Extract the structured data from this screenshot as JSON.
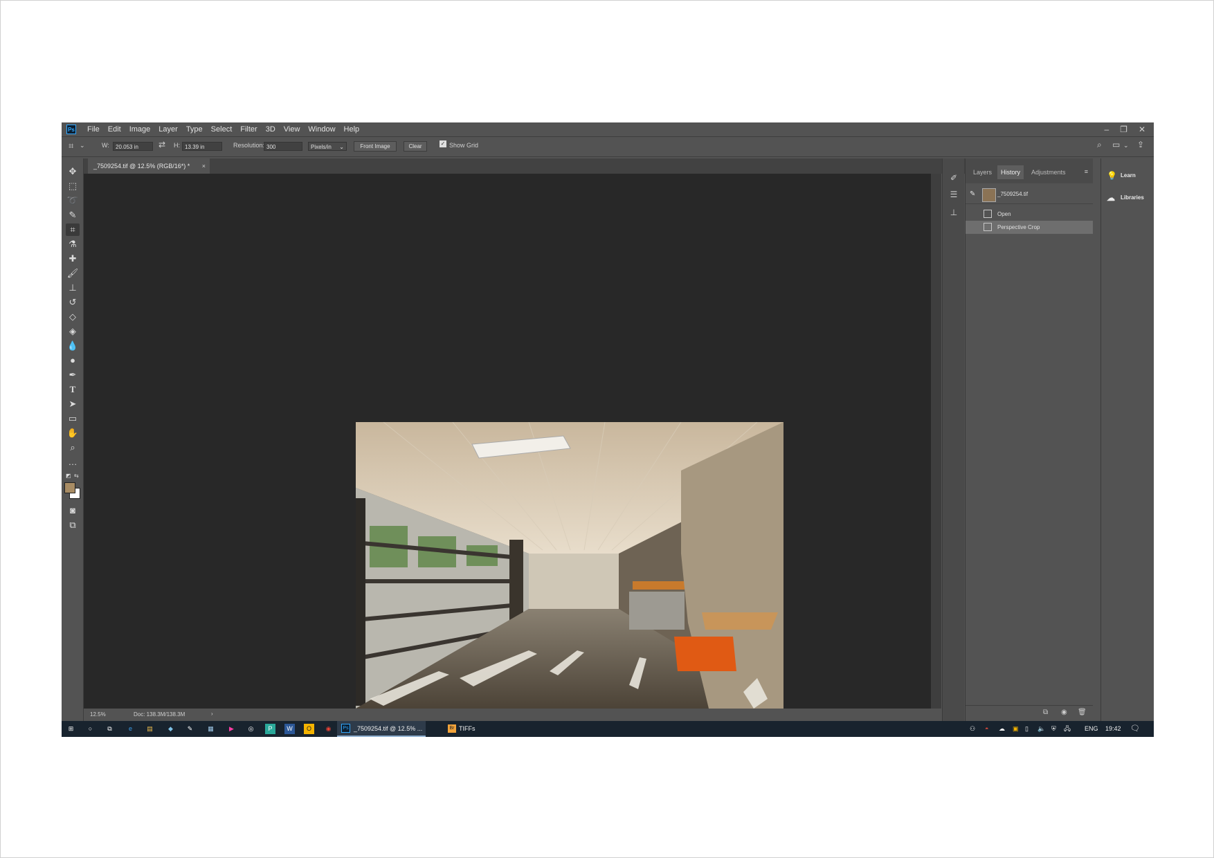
{
  "app": {
    "logo": "Ps"
  },
  "menu": [
    "File",
    "Edit",
    "Image",
    "Layer",
    "Type",
    "Select",
    "Filter",
    "3D",
    "View",
    "Window",
    "Help"
  ],
  "options": {
    "w_label": "W:",
    "w_value": "20.053 in",
    "h_label": "H:",
    "h_value": "13.39 in",
    "resolution_label": "Resolution:",
    "resolution_value": "300",
    "resolution_unit": "Pixels/in",
    "front_image_label": "Front Image",
    "clear_label": "Clear",
    "show_grid_label": "Show Grid",
    "show_grid_checked": true
  },
  "document_tab": {
    "title": "_7509254.tif @ 12.5% (RGB/16*) *",
    "close": "×"
  },
  "status": {
    "zoom": "12.5%",
    "doc": "Doc: 138.3M/138.3M",
    "arrow": "›"
  },
  "panel": {
    "tabs": [
      "Layers",
      "History",
      "Adjustments"
    ],
    "active_tab": "History",
    "snapshot_name": "_7509254.tif",
    "history_items": [
      "Open",
      "Perspective Crop"
    ],
    "selected_item": "Perspective Crop"
  },
  "learn_panel": {
    "items": [
      "Learn",
      "Libraries"
    ]
  },
  "colors": {
    "foreground": "#a88c64",
    "background": "#ffffff",
    "ui_bg": "#535353",
    "canvas_bg": "#282828",
    "accent": "#31a8ff"
  },
  "taskbar": {
    "active_app_label": "_7509254.tif @ 12.5% ...",
    "explorer_label": "TIFFs",
    "lang": "ENG",
    "time": "19:42"
  }
}
